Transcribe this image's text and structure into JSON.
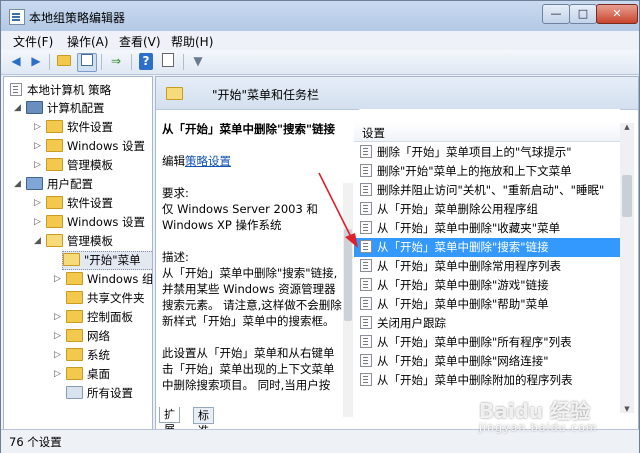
{
  "window": {
    "title": "本地组策略编辑器",
    "min": "—",
    "max": "□",
    "close": "✕"
  },
  "menu": [
    "文件(F)",
    "操作(A)",
    "查看(V)",
    "帮助(H)"
  ],
  "toolbar": {
    "back": "◀",
    "forward": "▶",
    "help": "?"
  },
  "tree": {
    "root": "本地计算机 策略",
    "computer_config": "计算机配置",
    "c_software": "软件设置",
    "c_windows": "Windows 设置",
    "c_admin": "管理模板",
    "user_config": "用户配置",
    "u_software": "软件设置",
    "u_windows": "Windows 设置",
    "u_admin": "管理模板",
    "start_menu": "\"开始\"菜单",
    "windows_components": "Windows 组",
    "shared_folders": "共享文件夹",
    "control_panel": "控制面板",
    "network": "网络",
    "system": "系统",
    "desktop": "桌面",
    "all_settings": "所有设置"
  },
  "header": {
    "title": "\"开始\"菜单和任务栏"
  },
  "description": {
    "policy_name": "从「开始」菜单中删除\"搜索\"链接",
    "edit_prefix": "编辑",
    "edit_link": "策略设置",
    "req_label": "要求:",
    "req_text": "仅 Windows Server 2003 和 Windows XP 操作系统",
    "desc_label": "描述:",
    "desc_text": "从「开始」菜单中删除\"搜索\"链接,并禁用某些 Windows 资源管理器搜索元素。 请注意,这样做不会删除新样式「开始」菜单中的搜索框。",
    "desc_text2": "此设置从「开始」菜单和从右键单击「开始」菜单出现的上下文菜单中删除搜索项目。 同时,当用户按"
  },
  "list": {
    "column": "设置",
    "rows": [
      "删除「开始」菜单项目上的\"气球提示\"",
      "删除\"开始\"菜单上的拖放和上下文菜单",
      "删除并阻止访问\"关机\"、\"重新启动\"、\"睡眠\"",
      "从「开始」菜单删除公用程序组",
      "从「开始」菜单中删除\"收藏夹\"菜单",
      "从「开始」菜单中删除\"搜索\"链接",
      "从「开始」菜单中删除常用程序列表",
      "从「开始」菜单中删除\"游戏\"链接",
      "从「开始」菜单中删除\"帮助\"菜单",
      "关闭用户跟踪",
      "从「开始」菜单中删除\"所有程序\"列表",
      "从「开始」菜单中删除\"网络连接\"",
      "从「开始」菜单中删除附加的程序列表"
    ],
    "selected_index": 5
  },
  "tabs": [
    "扩展",
    "标准"
  ],
  "status": "76 个设置",
  "watermark": {
    "brand": "Baidu 经验",
    "sub": "jingyan.baidu.com"
  },
  "colors": {
    "selection": "#3399ff",
    "link": "#0e52b8",
    "arrow": "#e0202a"
  }
}
